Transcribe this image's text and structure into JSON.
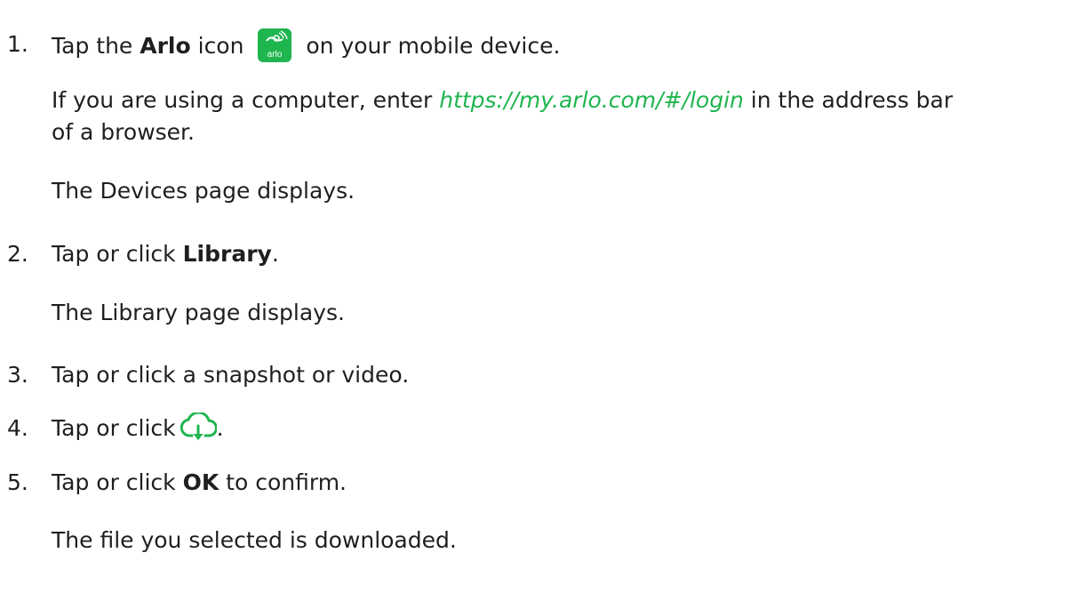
{
  "steps": [
    {
      "number": "1.",
      "before": "Tap the ",
      "bold": "Arlo",
      "middle": " icon",
      "after": " on your mobile device.",
      "icon_name": "arlo-app-icon",
      "icon_text": "arlo"
    },
    {
      "sub1_before": "If you are using a computer, enter ",
      "sub1_link": "https://my.arlo.com/#/login",
      "sub1_after": " in the address bar",
      "sub1_line2": "of a browser.",
      "sub2": "The Devices page displays."
    },
    {
      "number": "2.",
      "before": "Tap or click ",
      "bold": "Library",
      "after": ".",
      "sub": "The Library page displays."
    },
    {
      "number": "3.",
      "text": "Tap or click a snapshot or video."
    },
    {
      "number": "4.",
      "before": "Tap or click",
      "after": ".",
      "icon_name": "cloud-download-icon"
    },
    {
      "number": "5.",
      "before": "Tap or click ",
      "bold": "OK",
      "after": " to confirm.",
      "sub": "The file you selected is downloaded."
    }
  ],
  "colors": {
    "accent_green": "#1fb54f",
    "text": "#1f1f1f"
  }
}
